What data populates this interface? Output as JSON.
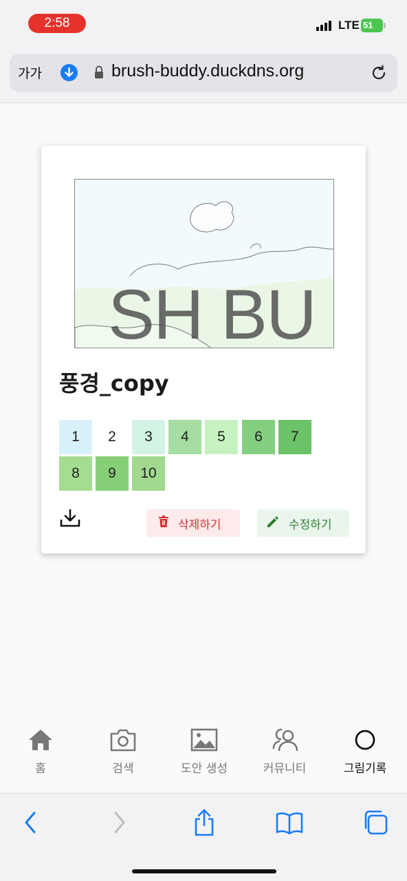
{
  "status": {
    "time": "2:58",
    "network": "LTE",
    "battery": "51"
  },
  "browser": {
    "text_size_label": "가가",
    "url": "brush-buddy.duckdns.org"
  },
  "card": {
    "watermark": "SH BU",
    "title": "풍경_copy",
    "palette": [
      {
        "label": "1",
        "color": "#d9f1fb"
      },
      {
        "label": "2",
        "color": "#ffffff"
      },
      {
        "label": "3",
        "color": "#d3f3e4"
      },
      {
        "label": "4",
        "color": "#a5dda3"
      },
      {
        "label": "5",
        "color": "#c6f2c1"
      },
      {
        "label": "6",
        "color": "#84cf7f"
      },
      {
        "label": "7",
        "color": "#6cc268"
      },
      {
        "label": "8",
        "color": "#a4dc90"
      },
      {
        "label": "9",
        "color": "#86cf76"
      },
      {
        "label": "10",
        "color": "#a1da8f"
      }
    ],
    "delete_label": "삭제하기",
    "edit_label": "수정하기"
  },
  "nav": {
    "items": [
      {
        "label": "홈",
        "icon": "home-icon"
      },
      {
        "label": "검색",
        "icon": "camera-icon"
      },
      {
        "label": "도안 생성",
        "icon": "image-icon"
      },
      {
        "label": "커뮤니티",
        "icon": "people-icon"
      },
      {
        "label": "그림기록",
        "icon": "circle-icon"
      }
    ],
    "active_index": 4
  },
  "colors": {
    "accent_red": "#d32f2f",
    "accent_green": "#2e7d32",
    "ios_blue": "#1a7cf5"
  }
}
